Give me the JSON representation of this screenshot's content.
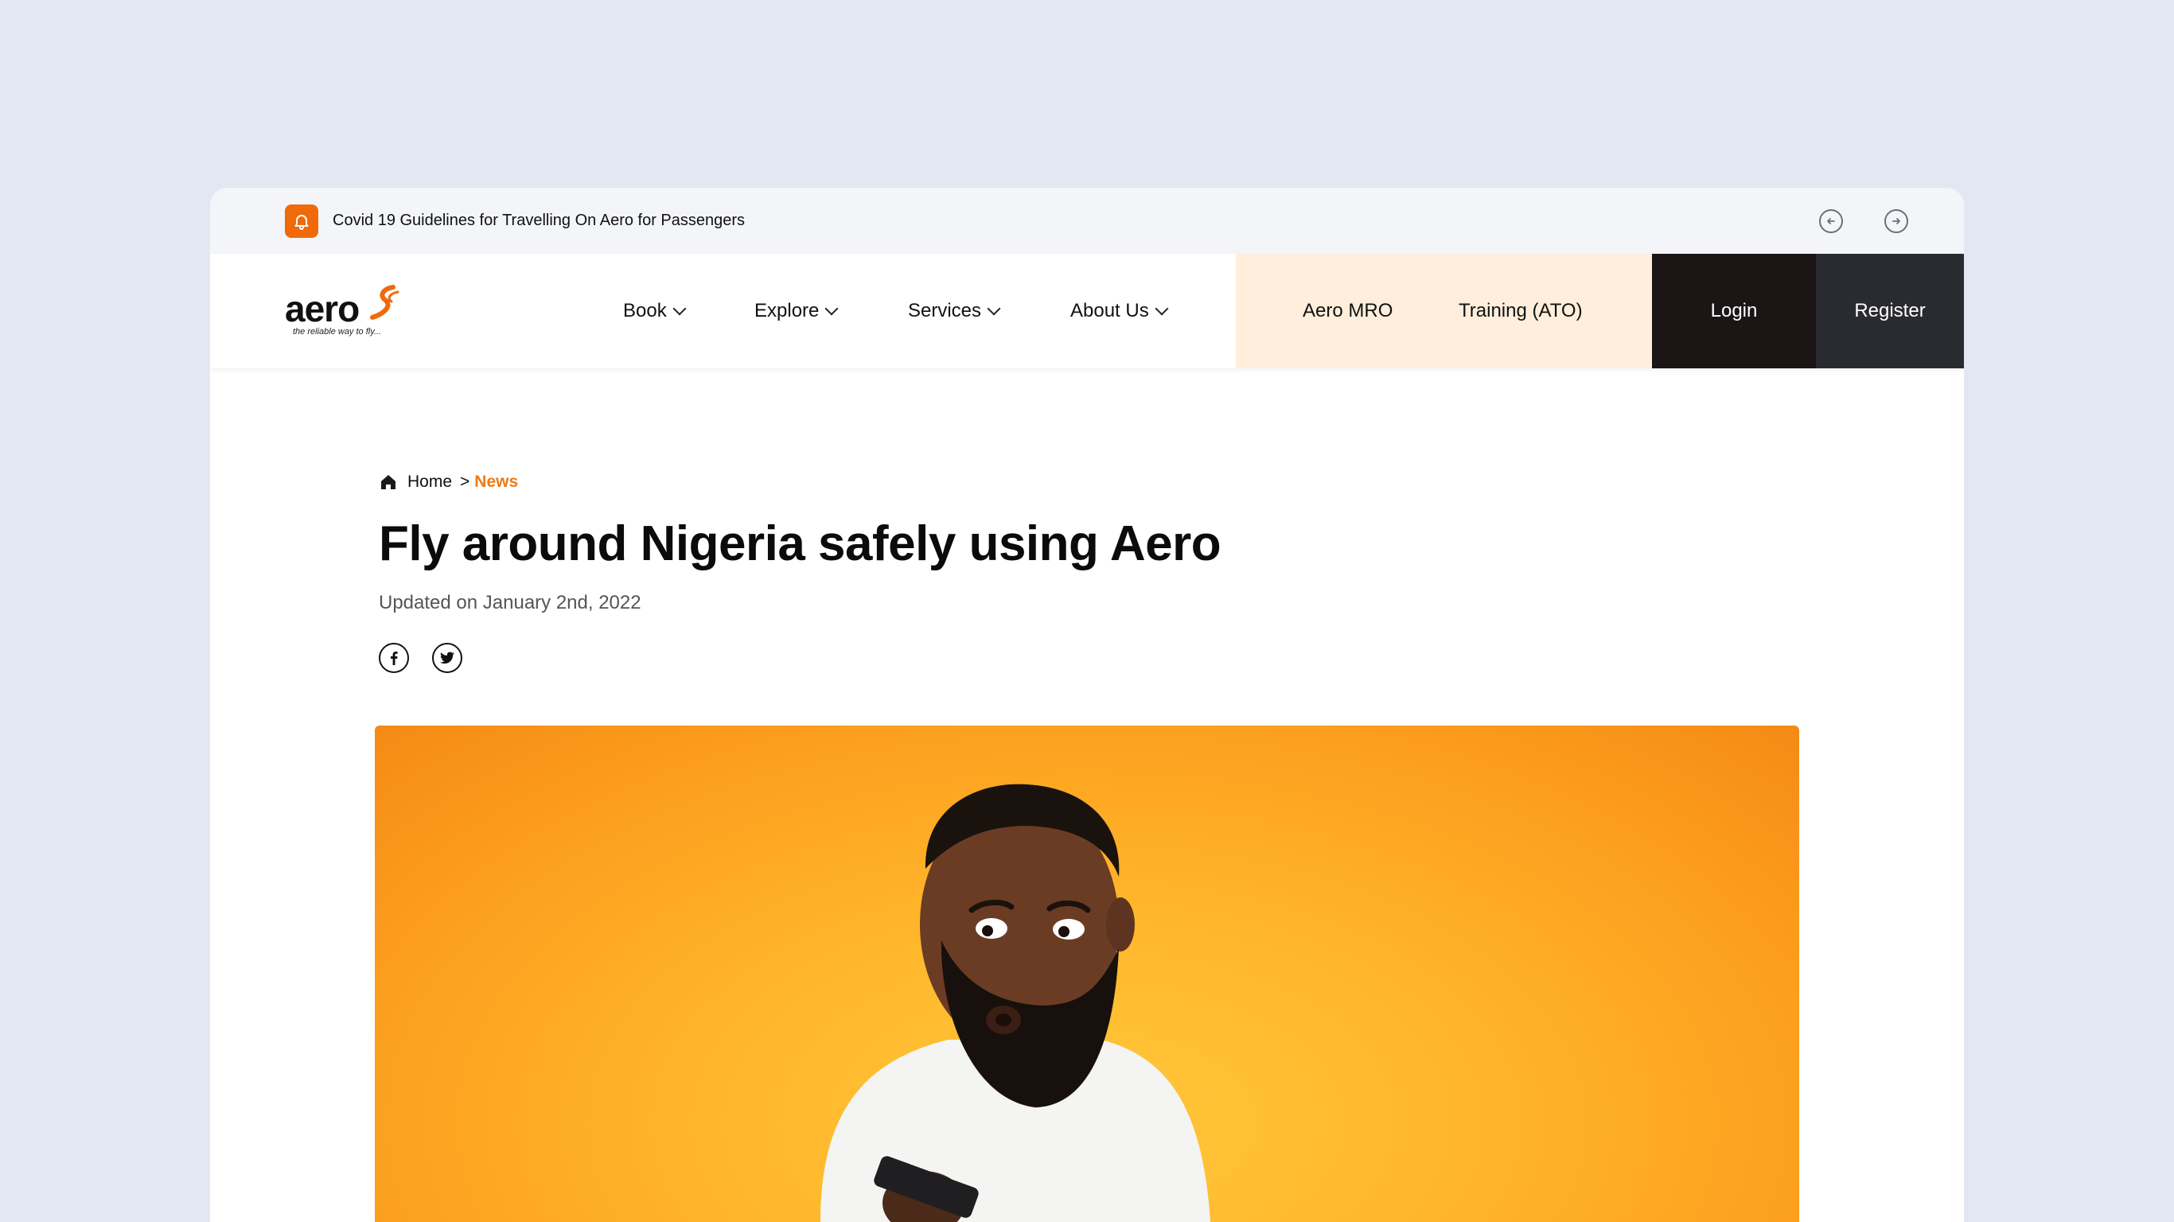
{
  "announcement": {
    "text": "Covid 19 Guidelines for Travelling On Aero for Passengers"
  },
  "brand": {
    "name": "aero",
    "tagline": "the reliable way to fly...",
    "accent": "#f06a0a"
  },
  "nav": {
    "items": [
      {
        "label": "Book"
      },
      {
        "label": "Explore"
      },
      {
        "label": "Services"
      },
      {
        "label": "About Us"
      }
    ],
    "secondary": [
      {
        "label": "Aero MRO"
      },
      {
        "label": "Training (ATO)"
      }
    ],
    "login": "Login",
    "register": "Register"
  },
  "breadcrumb": {
    "home": "Home",
    "separator": ">",
    "current": "News"
  },
  "article": {
    "title": "Fly around Nigeria safely using Aero",
    "updated": "Updated on January 2nd, 2022"
  },
  "colors": {
    "background": "#e3e7f1",
    "peach": "#feeedb",
    "login_bg": "#1b1515",
    "register_bg": "#2a2b30",
    "breadcrumb_active": "#f07a10"
  }
}
